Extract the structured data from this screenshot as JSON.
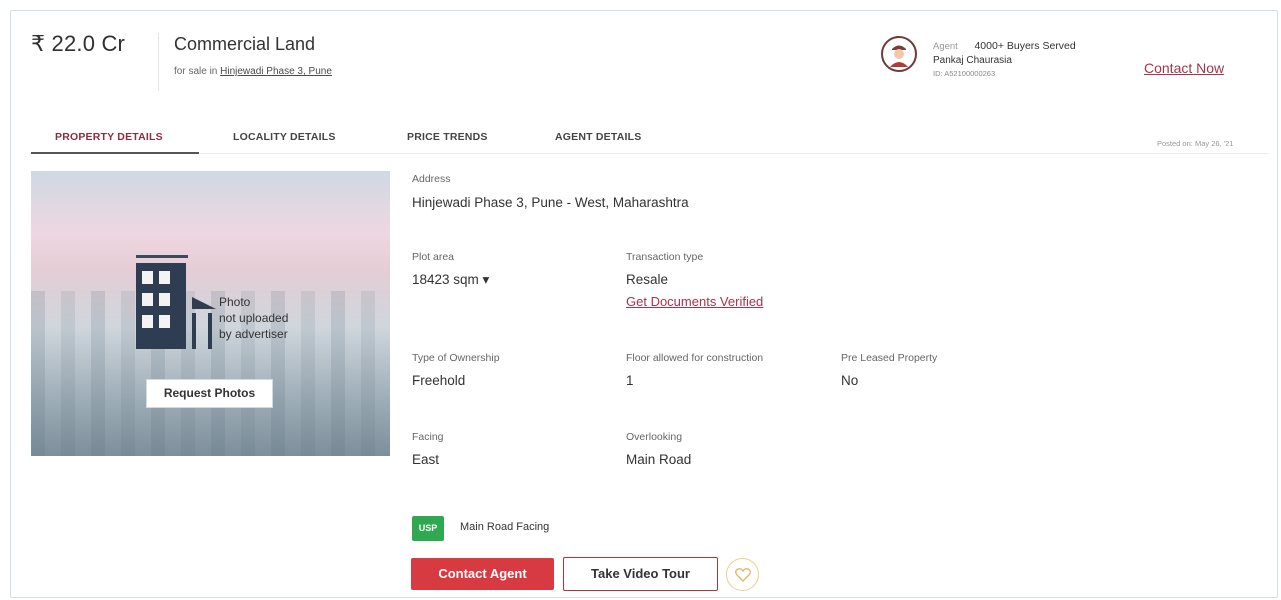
{
  "listing": {
    "price": "₹ 22.0 Cr",
    "property_type": "Commercial Land",
    "sale_prefix": "for sale in",
    "location_link": "Hinjewadi Phase 3, Pune"
  },
  "agent": {
    "label": "Agent",
    "buyers_served": "4000+ Buyers Served",
    "name": "Pankaj Chaurasia",
    "id": "ID: A52100000263",
    "contact_now": "Contact Now"
  },
  "tabs": [
    {
      "label": "PROPERTY DETAILS",
      "active": true
    },
    {
      "label": "LOCALITY DETAILS",
      "active": false
    },
    {
      "label": "PRICE TRENDS",
      "active": false
    },
    {
      "label": "AGENT DETAILS",
      "active": false
    }
  ],
  "posted_on": "Posted on: May 26, '21",
  "photo": {
    "text_line1": "Photo",
    "text_line2": "not uploaded",
    "text_line3": "by advertiser",
    "request_button": "Request Photos"
  },
  "details": {
    "address_label": "Address",
    "address_value": "Hinjewadi Phase 3, Pune - West, Maharashtra",
    "plot_area_label": "Plot area",
    "plot_area_value": "18423 sqm ▾",
    "transaction_label": "Transaction type",
    "transaction_value": "Resale",
    "verify_link": "Get Documents Verified",
    "ownership_label": "Type of Ownership",
    "ownership_value": "Freehold",
    "floors_label": "Floor allowed for construction",
    "floors_value": "1",
    "preleased_label": "Pre Leased Property",
    "preleased_value": "No",
    "facing_label": "Facing",
    "facing_value": "East",
    "overlooking_label": "Overlooking",
    "overlooking_value": "Main Road"
  },
  "usp": {
    "badge": "USP",
    "text": "Main Road Facing"
  },
  "actions": {
    "contact_agent": "Contact Agent",
    "video_tour": "Take Video Tour"
  },
  "colors": {
    "brand": "#a6344a",
    "primary_button": "#d83a42",
    "usp_badge": "#2fa84f",
    "active_tab": "#8a2e42"
  }
}
